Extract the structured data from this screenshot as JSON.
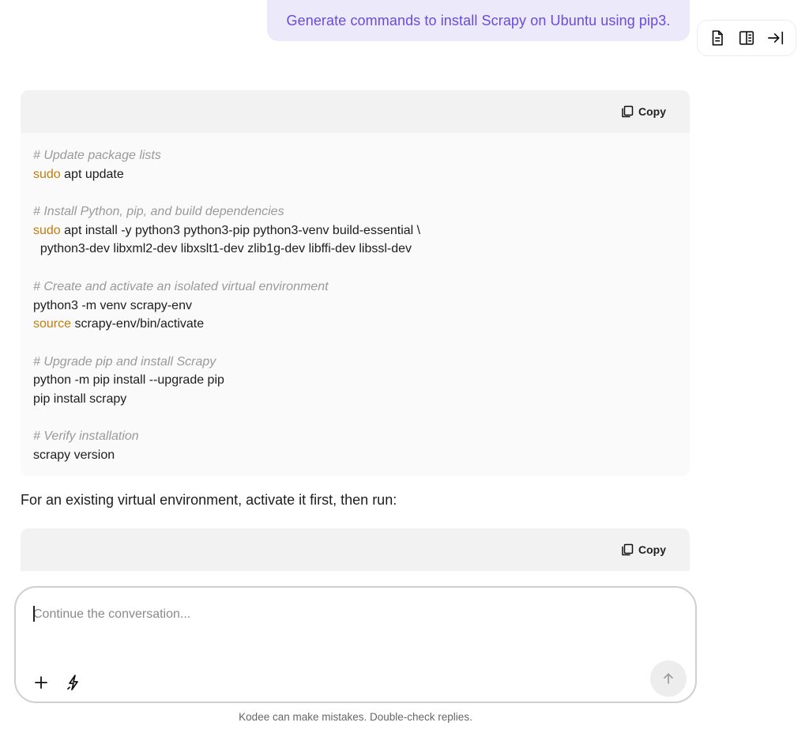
{
  "user_message": "Generate commands to install Scrapy on Ubuntu using pip3.",
  "toolbar": {
    "icons": [
      "document-icon",
      "book-icon",
      "collapse-right-icon"
    ]
  },
  "code_blocks": [
    {
      "copy_label": "Copy",
      "lines": [
        {
          "type": "comment",
          "text": "# Update package lists"
        },
        {
          "type": "cmd",
          "kw": "sudo",
          "text": " apt update"
        },
        {
          "type": "blank",
          "text": ""
        },
        {
          "type": "comment",
          "text": "# Install Python, pip, and build dependencies"
        },
        {
          "type": "cmd",
          "kw": "sudo",
          "text": " apt install -y python3 python3-pip python3-venv build-essential \\"
        },
        {
          "type": "plain",
          "text": "  python3-dev libxml2-dev libxslt1-dev zlib1g-dev libffi-dev libssl-dev"
        },
        {
          "type": "blank",
          "text": ""
        },
        {
          "type": "comment",
          "text": "# Create and activate an isolated virtual environment"
        },
        {
          "type": "plain",
          "text": "python3 -m venv scrapy-env"
        },
        {
          "type": "cmd",
          "kw": "source",
          "text": " scrapy-env/bin/activate"
        },
        {
          "type": "blank",
          "text": ""
        },
        {
          "type": "comment",
          "text": "# Upgrade pip and install Scrapy"
        },
        {
          "type": "plain",
          "text": "python -m pip install --upgrade pip"
        },
        {
          "type": "plain",
          "text": "pip install scrapy"
        },
        {
          "type": "blank",
          "text": ""
        },
        {
          "type": "comment",
          "text": "# Verify installation"
        },
        {
          "type": "plain",
          "text": "scrapy version"
        }
      ]
    },
    {
      "copy_label": "Copy",
      "lines": []
    }
  ],
  "paragraph": "For an existing virtual environment, activate it first, then run:",
  "composer": {
    "placeholder": "Continue the conversation..."
  },
  "disclaimer": "Kodee can make mistakes. Double-check replies.",
  "colors": {
    "accent": "#6a4cd6",
    "bubble_bg": "#ece9fb",
    "keyword": "#c17d0e",
    "comment": "#9a9a9a"
  }
}
